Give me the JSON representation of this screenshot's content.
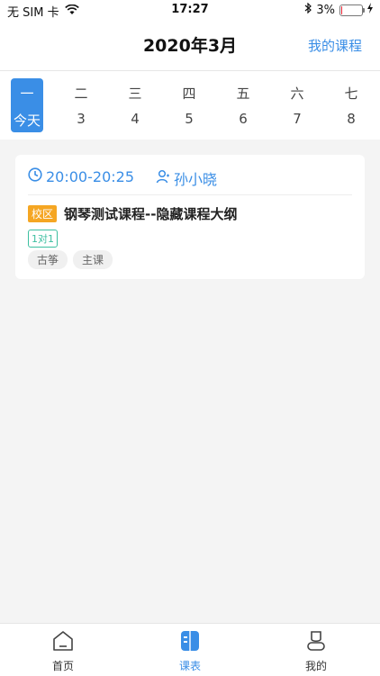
{
  "status_bar": {
    "carrier": "无 SIM 卡",
    "time": "17:27",
    "battery_percent": "3%",
    "battery_level": 0.03
  },
  "header": {
    "title": "2020年3月",
    "action": "我的课程"
  },
  "week": {
    "days": [
      {
        "weekday": "一",
        "date": "今天",
        "active": true
      },
      {
        "weekday": "二",
        "date": "3"
      },
      {
        "weekday": "三",
        "date": "4"
      },
      {
        "weekday": "四",
        "date": "5"
      },
      {
        "weekday": "五",
        "date": "6"
      },
      {
        "weekday": "六",
        "date": "7"
      },
      {
        "weekday": "七",
        "date": "8"
      }
    ]
  },
  "course_card": {
    "time_range": "20:00-20:25",
    "teacher": "孙小晓",
    "campus_badge": "校区",
    "course_name": "钢琴测试课程--隐藏课程大纲",
    "class_type": "1对1",
    "tags": [
      "古筝",
      "主课"
    ]
  },
  "tabbar": {
    "tabs": [
      {
        "label": "首页",
        "icon": "home-icon"
      },
      {
        "label": "课表",
        "icon": "schedule-icon",
        "active": true
      },
      {
        "label": "我的",
        "icon": "profile-icon"
      }
    ]
  },
  "colors": {
    "accent": "#3a8ee6",
    "campus_badge": "#f5a623",
    "class_type": "#3cbfa0"
  }
}
